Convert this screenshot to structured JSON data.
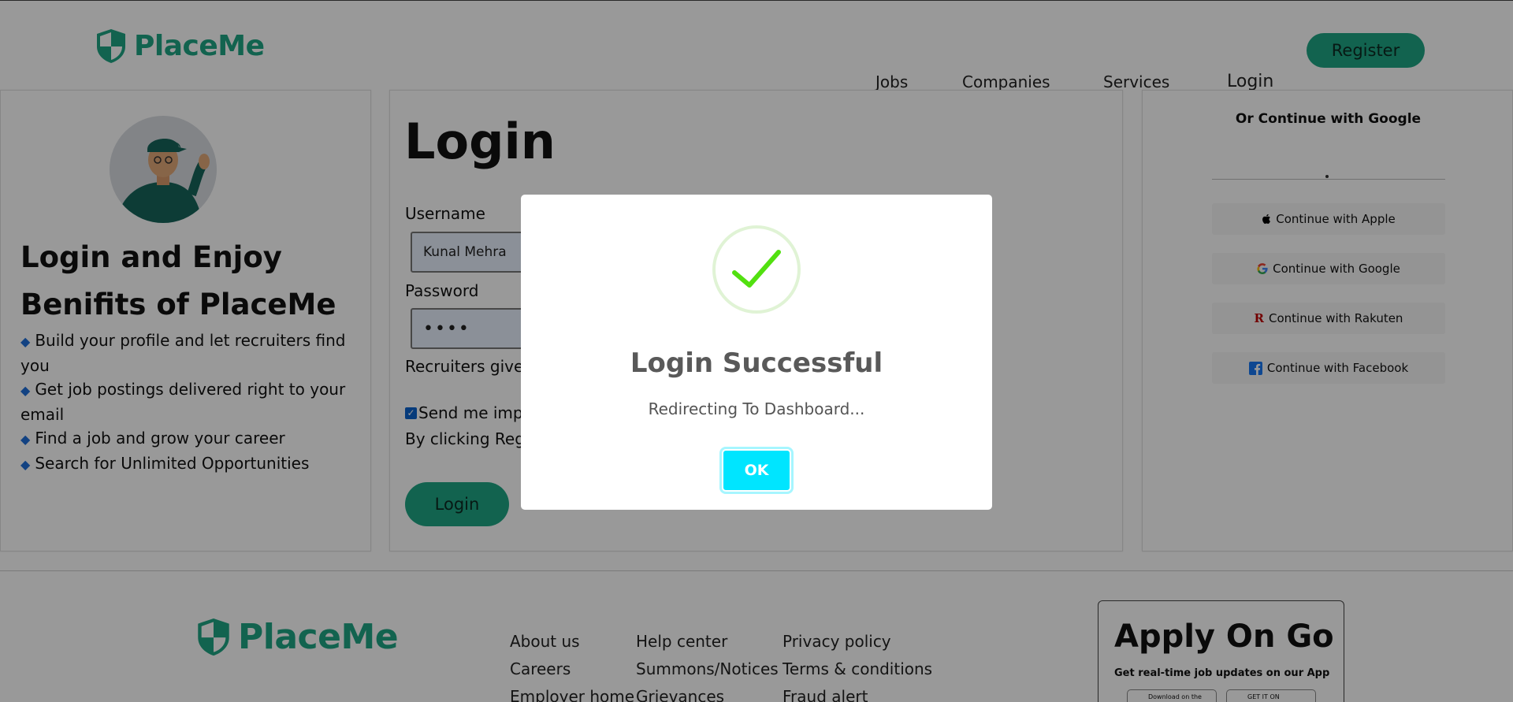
{
  "header": {
    "brand": "PlaceMe",
    "nav": [
      "Jobs",
      "Companies",
      "Services"
    ],
    "login": "Login",
    "register": "Register"
  },
  "left_panel": {
    "heading": "Login and Enjoy Benifits of PlaceMe",
    "benefits": [
      "Build your profile and let recruiters find you",
      "Get job postings delivered right to your email",
      "Find a job and grow your career",
      "Search for Unlimited Opportunities"
    ]
  },
  "login_form": {
    "title": "Login",
    "username_label": "Username",
    "username_value": "Kunal Mehra",
    "password_label": "Password",
    "password_value": "••••",
    "recruiters_text": "Recruiters give",
    "consent_text": "Send me imp",
    "terms_text": "By clicking Reg                                                                                        y of PlaceME.com",
    "submit": "Login"
  },
  "social_panel": {
    "heading": "Or Continue with Google",
    "buttons": [
      {
        "label": "Continue with Apple",
        "icon": "apple-icon"
      },
      {
        "label": "Continue with Google",
        "icon": "google-icon"
      },
      {
        "label": "Continue with Rakuten",
        "icon": "rakuten-icon"
      },
      {
        "label": "Continue with Facebook",
        "icon": "facebook-icon"
      }
    ]
  },
  "footer": {
    "brand": "PlaceMe",
    "col1": [
      "About us",
      "Careers",
      "Employer home"
    ],
    "col2": [
      "Help center",
      "Summons/Notices",
      "Grievances"
    ],
    "col3": [
      "Privacy policy",
      "Terms & conditions",
      "Fraud alert"
    ],
    "app_title": "Apply On Go",
    "app_sub": "Get real-time job updates on our App",
    "badge_apple": "Download on the",
    "badge_google": "GET IT ON"
  },
  "modal": {
    "title": "Login Successful",
    "text": "Redirecting To Dashboard...",
    "ok": "OK"
  },
  "colors": {
    "brand": "#1fa584",
    "ok_button": "#00e5ff",
    "success_check": "#52e010"
  }
}
